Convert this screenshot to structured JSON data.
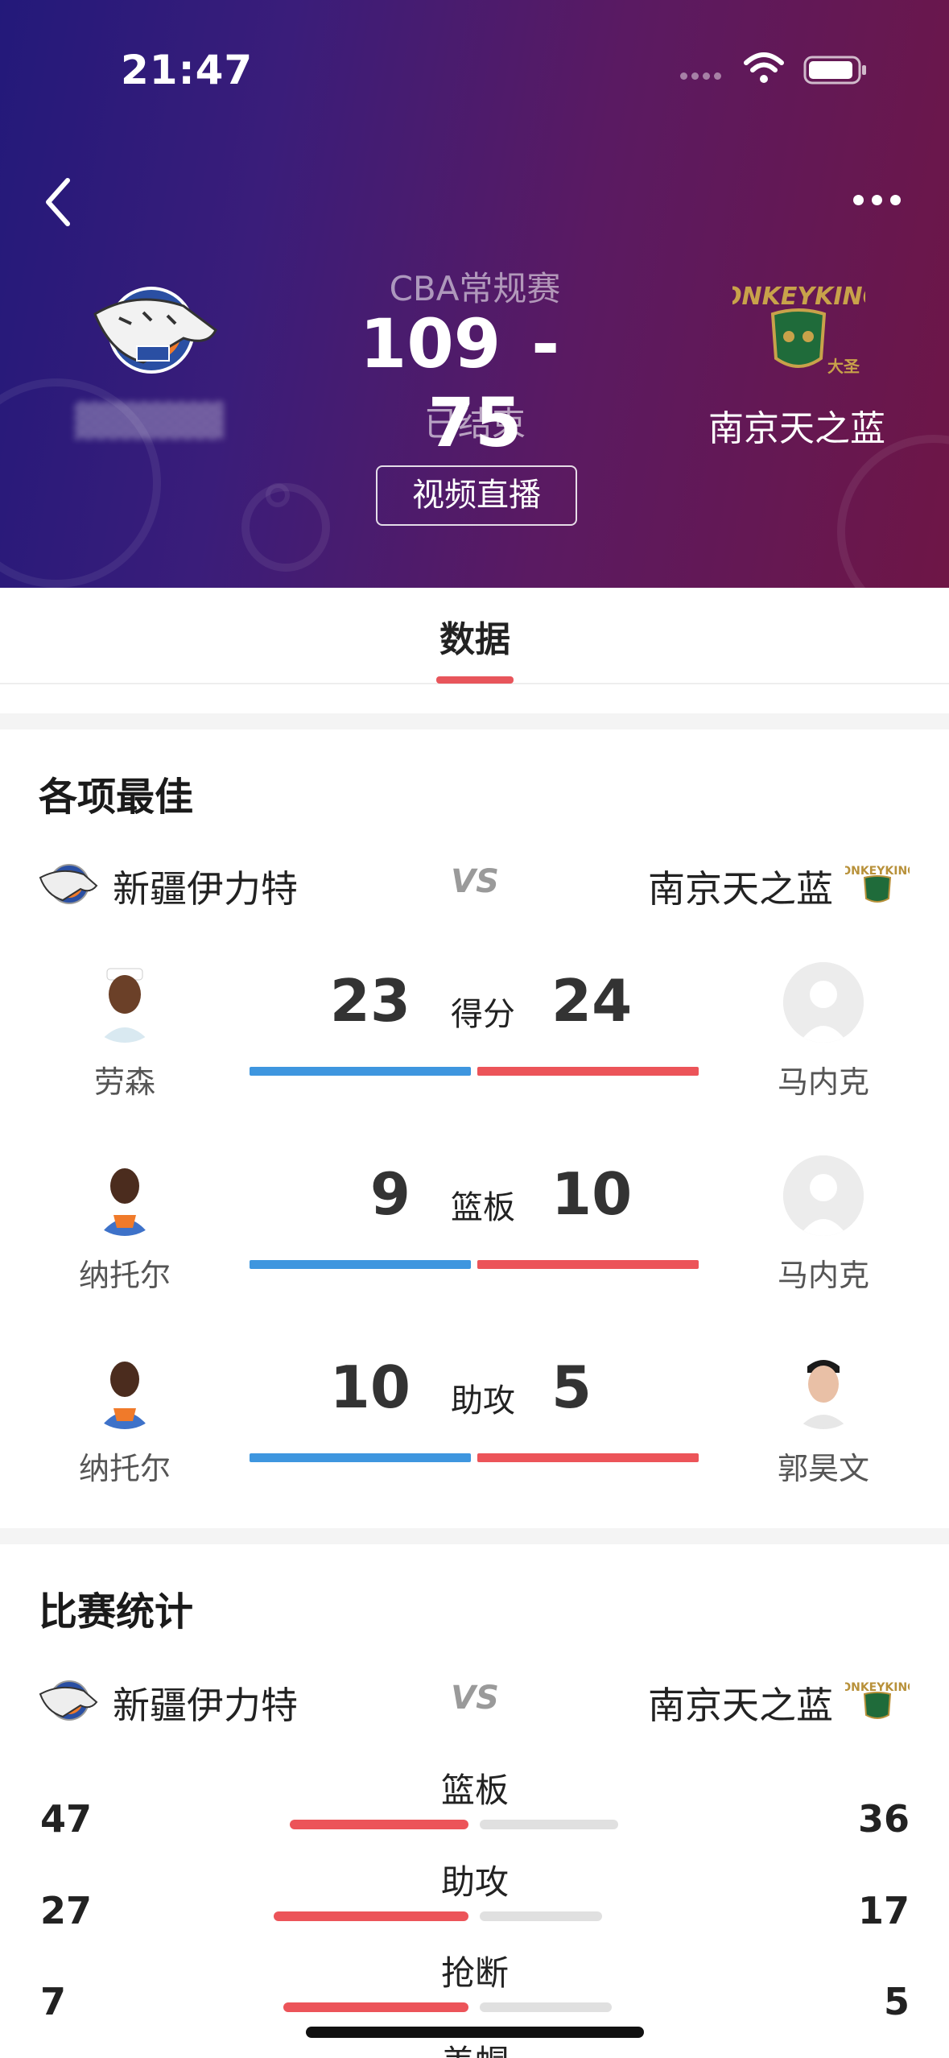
{
  "status_bar": {
    "time": "21:47"
  },
  "header": {
    "league": "CBA常规赛",
    "home_score": "109",
    "separator": "-",
    "away_score": "75",
    "game_status": "已结束",
    "away_team_name": "南京天之蓝",
    "live_button": "视频直播"
  },
  "tabs": [
    {
      "label": "数据",
      "active": true
    }
  ],
  "best": {
    "title": "各项最佳",
    "home_team": "新疆伊力特",
    "vs": "VS",
    "away_team": "南京天之蓝",
    "rows": [
      {
        "category": "得分",
        "home_player": "劳森",
        "home_value": "23",
        "away_player": "马内克",
        "away_value": "24"
      },
      {
        "category": "篮板",
        "home_player": "纳托尔",
        "home_value": "9",
        "away_player": "马内克",
        "away_value": "10"
      },
      {
        "category": "助攻",
        "home_player": "纳托尔",
        "home_value": "10",
        "away_player": "郭昊文",
        "away_value": "5"
      }
    ]
  },
  "stats": {
    "title": "比赛统计",
    "home_team": "新疆伊力特",
    "vs": "VS",
    "away_team": "南京天之蓝",
    "rows": [
      {
        "label": "篮板",
        "home": "47",
        "away": "36"
      },
      {
        "label": "助攻",
        "home": "27",
        "away": "17"
      },
      {
        "label": "抢断",
        "home": "7",
        "away": "5"
      },
      {
        "label": "盖帽",
        "home": "",
        "away": ""
      }
    ]
  },
  "colors": {
    "accent_red": "#ec5459",
    "home_blue": "#3e96df",
    "header_gradient_start": "#23197a",
    "header_gradient_end": "#6e1646"
  },
  "icons": {
    "back": "chevron-left-icon",
    "more": "more-dots-icon",
    "wifi": "wifi-icon",
    "battery": "battery-icon"
  }
}
